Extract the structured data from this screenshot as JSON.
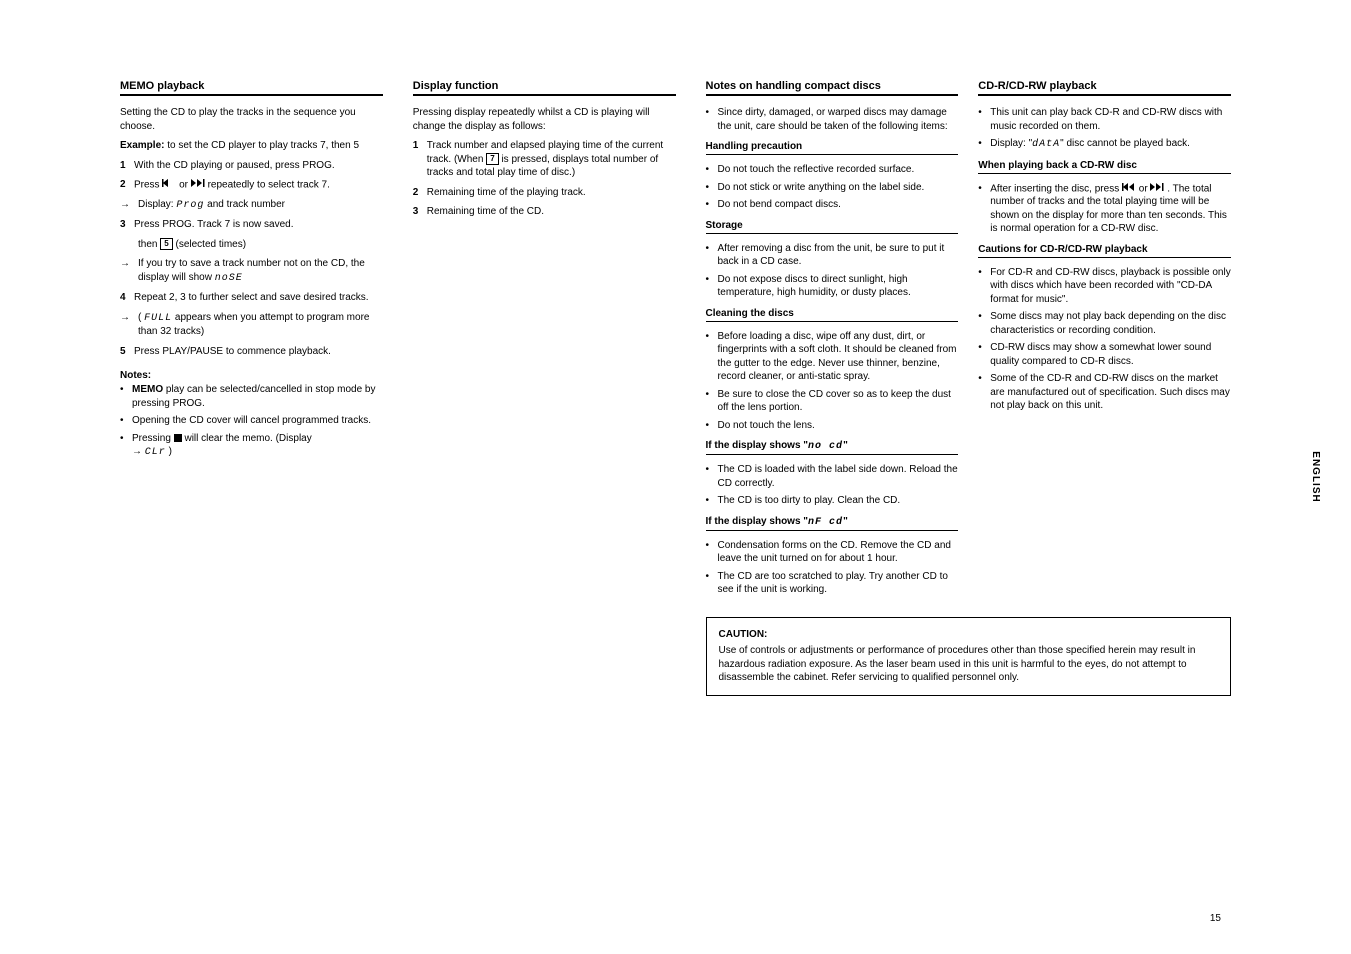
{
  "col1": {
    "title": "MEMO playback",
    "intro": "Setting the CD to play the tracks in the sequence you choose.",
    "ex_lead": "Example:",
    "ex_body": "to set the CD player to play tracks 7, then 5",
    "s1": "With the CD playing or paused, press PROG.",
    "s2a": "Press ",
    "s2b": " or ",
    "s2c": " repeatedly to select track 7.",
    "sub2": [
      "Display: ",
      "Prog",
      " and track number"
    ],
    "s3": "Press PROG. Track 7 is now saved.",
    "sub3a": [
      "then ",
      "5",
      " (selected times)"
    ],
    "sub3b": [
      "If you try to save a track number not on the CD, the display will show ",
      "noSE"
    ],
    "s4": "Repeat 2, 3 to further select and save desired tracks.",
    "sub4": [
      "(",
      "FULL",
      " appears when you attempt to program more than 32 tracks)"
    ],
    "s5": "Press PLAY/PAUSE to commence playback.",
    "notes_hdr": "Notes:",
    "n1a": "MEMO",
    "n1b": " play can be selected/cancelled in stop mode by pressing PROG.",
    "n2": "Opening the CD cover will cancel programmed tracks.",
    "n3a": "Pressing ",
    "n3b": " will clear the memo. (Display ",
    "n3c": "CLr",
    "n3d": ")"
  },
  "col2": {
    "title": "Display function",
    "intro": "Pressing display repeatedly whilst a CD is playing will change the display as follows:",
    "s1a": "Track number and elapsed playing time of the current track. (When ",
    "s1b": "7",
    "s1c": " is pressed, displays total number of tracks and total play time of disc.)",
    "s2": "Remaining time of the playing track.",
    "s3": "Remaining time of the CD."
  },
  "col3": {
    "title": "Notes on handling compact discs",
    "b1": "Since dirty, damaged, or warped discs may damage the unit, care should be taken of the following items:",
    "h1": "Handling precaution",
    "b2": "Do not touch the reflective recorded surface.",
    "b3": "Do not stick or write anything on the label side.",
    "b4": "Do not bend compact discs.",
    "h2": "Storage",
    "b5": "After removing a disc from the unit, be sure to put it back in a CD case.",
    "b6": "Do not expose discs to direct sunlight, high temperature, high humidity, or dusty places.",
    "h3": "Cleaning the discs",
    "b7": "Before loading a disc, wipe off any dust, dirt, or fingerprints with a soft cloth. It should be cleaned from the gutter to the edge. Never use thinner, benzine, record cleaner, or anti-static spray.",
    "b8": "Be sure to close the CD cover so as to keep the dust off the lens portion.",
    "b9": "Do not touch the lens.",
    "h4": "If the display shows \"no cd\"",
    "nocd": "no cd",
    "b10": "The CD is loaded with the label side down. Reload the CD correctly.",
    "b11": "The CD is too dirty to play. Clean the CD.",
    "h5": "If the display shows \"nF cd\"",
    "nfcd": "nF cd",
    "b12": "Condensation forms on the CD. Remove the CD and leave the unit turned on for about 1 hour.",
    "b13": "The CD are too scratched to play. Try another CD to see if the unit is working.",
    "caution_hdr": "CAUTION:",
    "caution_body": "Use of controls or adjustments or performance of procedures other than those specified herein may result in hazardous radiation exposure. As the laser beam used in this unit is harmful to the eyes, do not attempt to disassemble the cabinet. Refer servicing to qualified personnel only."
  },
  "col4": {
    "title": "CD-R/CD-RW playback",
    "b1": "This unit can play back CD-R and CD-RW discs with music recorded on them.",
    "b2": [
      "Display: \"",
      "dAtA",
      "\" disc cannot be played back."
    ],
    "h1": "When playing back a CD-RW disc",
    "b3a": "After inserting the disc, press ",
    "b3b": " or ",
    "b3c": ". The total number of tracks and the total playing time will be shown on the display for more than ten seconds. This is normal operation for a CD-RW disc.",
    "h2": "Cautions for CD-R/CD-RW playback",
    "c1": "For CD-R and CD-RW discs, playback is possible only with discs which have been recorded with \"CD-DA format for music\".",
    "c2": "Some discs may not play back depending on the disc characteristics or recording condition.",
    "c3": "CD-RW discs may show a somewhat lower sound quality compared to CD-R discs.",
    "c4": "Some of the CD-R and CD-RW discs on the market are manufactured out of specification. Such discs may not play back on this unit."
  },
  "page_num": "15",
  "sidebar": "ENGLISH"
}
